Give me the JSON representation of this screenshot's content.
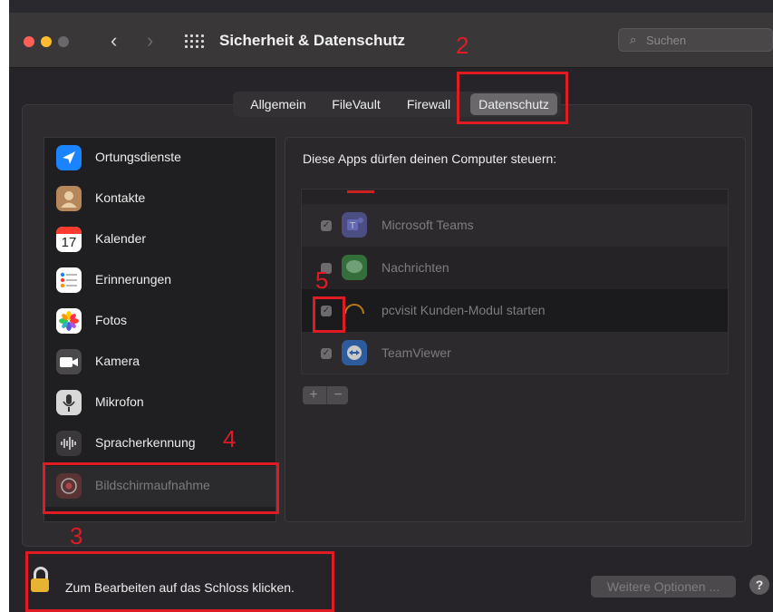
{
  "window": {
    "title": "Sicherheit & Datenschutz",
    "search_placeholder": "Suchen",
    "nav_back": "‹",
    "nav_forward": "›"
  },
  "tabs": [
    {
      "label": "Allgemein",
      "active": false
    },
    {
      "label": "FileVault",
      "active": false
    },
    {
      "label": "Firewall",
      "active": false
    },
    {
      "label": "Datenschutz",
      "active": true
    }
  ],
  "sidebar": {
    "items": [
      {
        "label": "Ortungsdienste",
        "icon": "location-arrow-icon"
      },
      {
        "label": "Kontakte",
        "icon": "contacts-icon"
      },
      {
        "label": "Kalender",
        "icon": "calendar-icon",
        "icon_text": "17"
      },
      {
        "label": "Erinnerungen",
        "icon": "reminders-icon"
      },
      {
        "label": "Fotos",
        "icon": "photos-icon"
      },
      {
        "label": "Kamera",
        "icon": "camera-icon"
      },
      {
        "label": "Mikrofon",
        "icon": "microphone-icon"
      },
      {
        "label": "Spracherkennung",
        "icon": "speech-recognition-icon"
      },
      {
        "label": "Bildschirmaufnahme",
        "icon": "screen-recording-icon"
      }
    ]
  },
  "main": {
    "heading": "Diese Apps dürfen deinen Computer steuern:",
    "apps": [
      {
        "name": "Microsoft Teams",
        "checked": true
      },
      {
        "name": "Nachrichten",
        "checked": false
      },
      {
        "name": "pcvisit Kunden-Modul starten",
        "checked": true
      },
      {
        "name": "TeamViewer",
        "checked": true
      }
    ],
    "add_label": "+",
    "remove_label": "−"
  },
  "footer": {
    "lock_text": "Zum Bearbeiten auf das Schloss klicken.",
    "more_options": "Weitere Optionen ...",
    "help": "?"
  },
  "annotations": {
    "step2": "2",
    "step3": "3",
    "step4": "4",
    "step5": "5"
  },
  "colors": {
    "annotation_red": "#e01b24",
    "lock_gold": "#e8b332",
    "close": "#ff5f57",
    "minimize": "#febc2e"
  }
}
